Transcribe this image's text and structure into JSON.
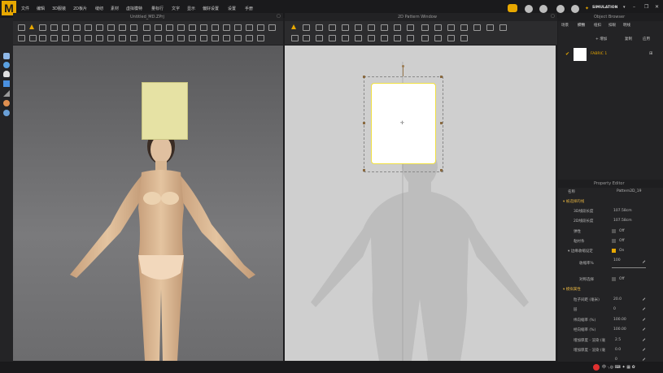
{
  "app": {
    "logo": "M",
    "title_3d": "Untitled_MD.ZPrj",
    "title_2d": "2D Pattern Window",
    "title_obj": "Object Browser",
    "title_prop": "Property Editor"
  },
  "menu": [
    "文件",
    "编辑",
    "3D服装",
    "2D板片",
    "缝纫",
    "素材",
    "虚拟模特",
    "量标行",
    "文字",
    "显示",
    "偏好设置",
    "设置",
    "手册"
  ],
  "user": {
    "simulation_label": "SIMULATION"
  },
  "object_browser": {
    "tabs": [
      "场景",
      "织物",
      "纽扣",
      "扣眼",
      "明线"
    ],
    "buttons": [
      "+ 增加",
      "复制",
      "应用"
    ],
    "fabric_item": "FABRIC 1"
  },
  "property_editor": {
    "name_label": "名称",
    "name_value": "Pattern2D_19",
    "sections": [
      {
        "label": "▾ 被选择的线",
        "rows": [
          {
            "label": "3D线段长度",
            "value": "107.58cm"
          },
          {
            "label": "2D线段长度",
            "value": "107.58cm"
          },
          {
            "label": "弹性",
            "value": "Off"
          },
          {
            "label": "粘衬条",
            "value": "Off"
          },
          {
            "label": "▾ 边缘收缩设定",
            "value": "On"
          },
          {
            "label": "收缩率%",
            "value": "100"
          },
          {
            "label": "对称选择",
            "value": "Off"
          }
        ]
      },
      {
        "label": "▾ 模拟属性",
        "rows": [
          {
            "label": "粒子间距 (毫米)",
            "value": "20.0"
          },
          {
            "label": "层",
            "value": "0"
          },
          {
            "label": "纬向缩率 (%)",
            "value": "100.00"
          },
          {
            "label": "经向缩率 (%)",
            "value": "100.00"
          },
          {
            "label": "增加厚度 - 渲染 (毫",
            "value": "2.5"
          },
          {
            "label": "增加厚度 - 渲染 (毫",
            "value": "0.0"
          },
          {
            "label": "",
            "value": "0"
          }
        ]
      }
    ]
  },
  "colors": {
    "accent": "#e8a800",
    "selection": "#f0e040",
    "pattern_fill": "#ffffff",
    "pattern_3d": "#e6e2a4"
  }
}
